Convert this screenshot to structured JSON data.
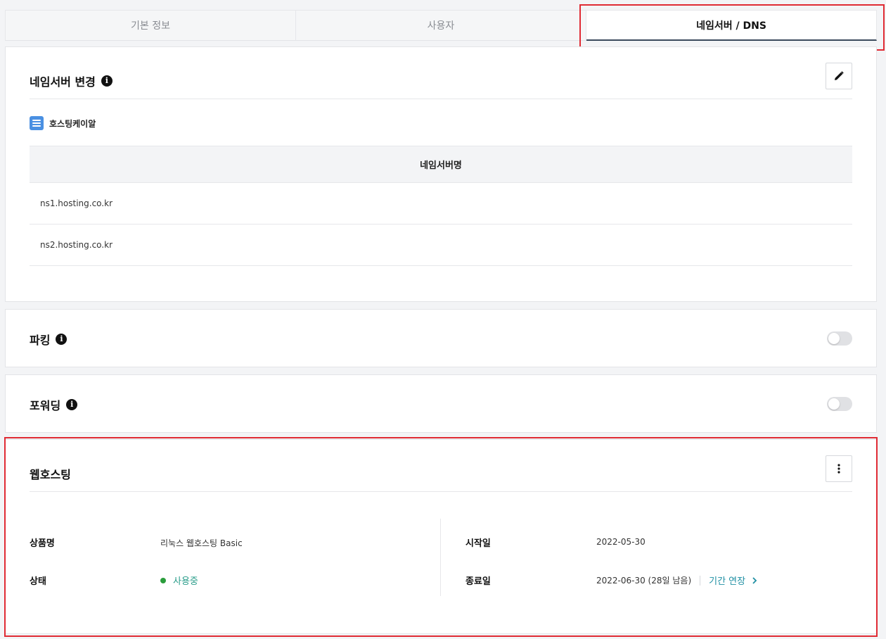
{
  "tabs": [
    {
      "label": "기본 정보",
      "active": false
    },
    {
      "label": "사용자",
      "active": false
    },
    {
      "label": "네임서버 / DNS",
      "active": true
    }
  ],
  "nameserver": {
    "title": "네임서버 변경",
    "provider": "호스팅케이알",
    "table_header": "네임서버명",
    "rows": [
      "ns1.hosting.co.kr",
      "ns2.hosting.co.kr"
    ]
  },
  "parking": {
    "title": "파킹",
    "enabled": false
  },
  "forwarding": {
    "title": "포워딩",
    "enabled": false
  },
  "webhosting": {
    "title": "웹호스팅",
    "product_label": "상품명",
    "product_value": "리눅스 웹호스팅 Basic",
    "status_label": "상태",
    "status_value": "사용중",
    "start_label": "시작일",
    "start_value": "2022-05-30",
    "end_label": "종료일",
    "end_value": "2022-06-30 (28일 남음)",
    "extend_label": "기간 연장"
  },
  "colors": {
    "highlight": "#e02b34",
    "status": "#2a9d3c",
    "link": "#1f8fa3",
    "provider_icon": "#4a90e2"
  },
  "icons": {
    "info": "info-icon",
    "edit": "pencil-icon",
    "more": "more-vertical-icon",
    "chevron": "chevron-right-icon",
    "provider": "server-icon"
  }
}
